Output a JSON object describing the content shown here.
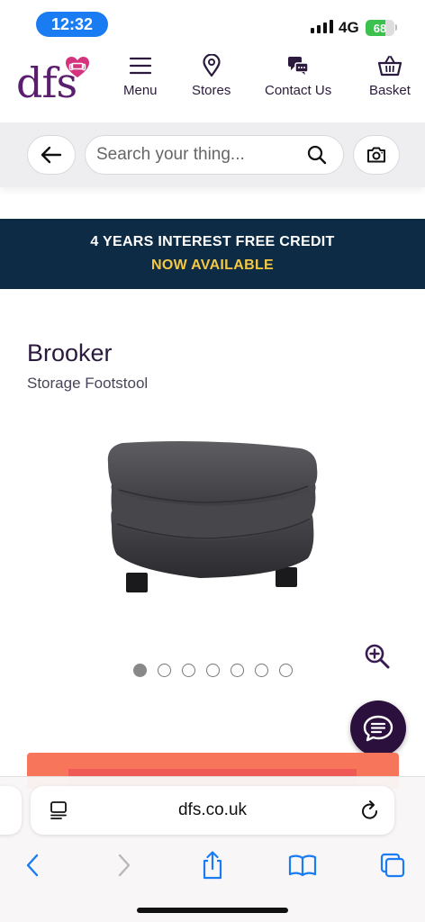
{
  "status_bar": {
    "time": "12:32",
    "network": "4G",
    "battery": "68",
    "battery_level": 0.68
  },
  "header": {
    "logo": "dfs",
    "nav": [
      {
        "label": "Menu",
        "icon": "hamburger-icon"
      },
      {
        "label": "Stores",
        "icon": "location-pin-icon"
      },
      {
        "label": "Contact Us",
        "icon": "chat-bubbles-icon"
      },
      {
        "label": "Basket",
        "icon": "basket-icon"
      }
    ]
  },
  "search": {
    "placeholder": "Search your thing..."
  },
  "promo": {
    "line1": "4 YEARS INTEREST FREE CREDIT",
    "line2": "NOW AVAILABLE"
  },
  "product": {
    "name": "Brooker",
    "subtitle": "Storage Footstool",
    "image_count": 7,
    "active_image": 1
  },
  "browser": {
    "url": "dfs.co.uk"
  },
  "colors": {
    "brand": "#5a1e6e",
    "brand_pink": "#d6337f",
    "promo_bg": "#0d2b45",
    "promo_accent": "#f5c842",
    "ios_blue": "#1a7cf3"
  }
}
